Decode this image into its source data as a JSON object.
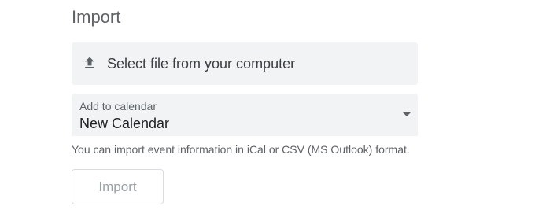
{
  "section": {
    "title": "Import"
  },
  "file_select": {
    "label": "Select file from your computer",
    "icon": "upload-icon"
  },
  "calendar_select": {
    "caption": "Add to calendar",
    "value": "New Calendar",
    "icon": "caret-down-icon"
  },
  "help_text": "You can import event information in iCal or CSV (MS Outlook) format.",
  "import_button": {
    "label": "Import",
    "disabled": true
  },
  "colors": {
    "field_background": "#f1f3f4",
    "text_primary": "#202124",
    "text_secondary": "#5f6368",
    "button_border": "#dadce0",
    "button_text_disabled": "#9aa0a6"
  }
}
